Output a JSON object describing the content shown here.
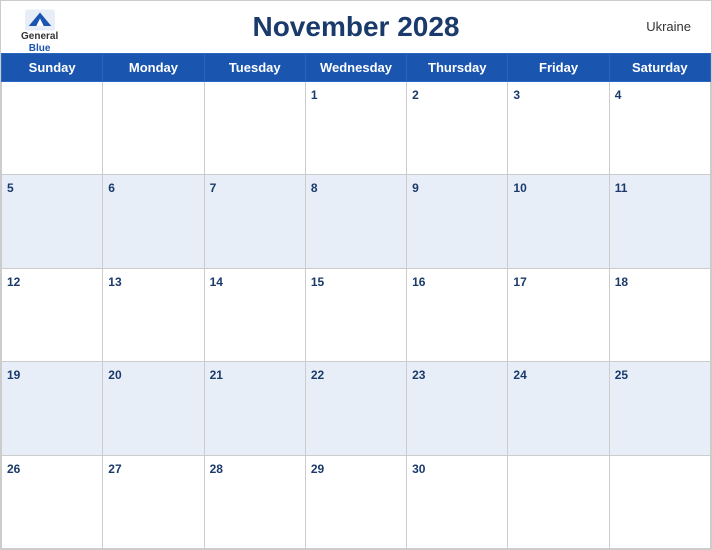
{
  "header": {
    "title": "November 2028",
    "country": "Ukraine",
    "logo": {
      "general": "General",
      "blue": "Blue"
    }
  },
  "weekdays": [
    "Sunday",
    "Monday",
    "Tuesday",
    "Wednesday",
    "Thursday",
    "Friday",
    "Saturday"
  ],
  "weeks": [
    [
      {
        "day": "",
        "empty": true
      },
      {
        "day": "",
        "empty": true
      },
      {
        "day": "",
        "empty": true
      },
      {
        "day": "1",
        "empty": false
      },
      {
        "day": "2",
        "empty": false
      },
      {
        "day": "3",
        "empty": false
      },
      {
        "day": "4",
        "empty": false
      }
    ],
    [
      {
        "day": "5",
        "empty": false
      },
      {
        "day": "6",
        "empty": false
      },
      {
        "day": "7",
        "empty": false
      },
      {
        "day": "8",
        "empty": false
      },
      {
        "day": "9",
        "empty": false
      },
      {
        "day": "10",
        "empty": false
      },
      {
        "day": "11",
        "empty": false
      }
    ],
    [
      {
        "day": "12",
        "empty": false
      },
      {
        "day": "13",
        "empty": false
      },
      {
        "day": "14",
        "empty": false
      },
      {
        "day": "15",
        "empty": false
      },
      {
        "day": "16",
        "empty": false
      },
      {
        "day": "17",
        "empty": false
      },
      {
        "day": "18",
        "empty": false
      }
    ],
    [
      {
        "day": "19",
        "empty": false
      },
      {
        "day": "20",
        "empty": false
      },
      {
        "day": "21",
        "empty": false
      },
      {
        "day": "22",
        "empty": false
      },
      {
        "day": "23",
        "empty": false
      },
      {
        "day": "24",
        "empty": false
      },
      {
        "day": "25",
        "empty": false
      }
    ],
    [
      {
        "day": "26",
        "empty": false
      },
      {
        "day": "27",
        "empty": false
      },
      {
        "day": "28",
        "empty": false
      },
      {
        "day": "29",
        "empty": false
      },
      {
        "day": "30",
        "empty": false
      },
      {
        "day": "",
        "empty": true
      },
      {
        "day": "",
        "empty": true
      }
    ]
  ],
  "shaded_rows": [
    1,
    3
  ],
  "colors": {
    "header_bg": "#1a56b0",
    "header_text": "#ffffff",
    "title_color": "#1a3a6b",
    "day_number_color": "#1a3a6b",
    "shaded_row_bg": "#e8eef8",
    "border_color": "#cccccc"
  }
}
